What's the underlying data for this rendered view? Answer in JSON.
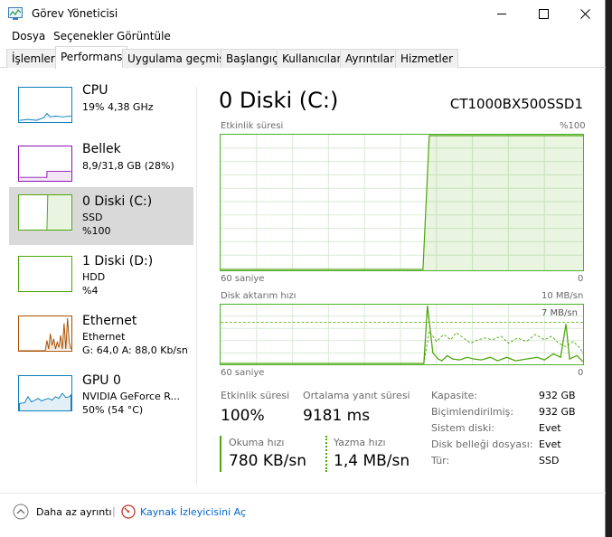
{
  "window": {
    "title": "Görev Yöneticisi",
    "minimize": "—",
    "maximize": "☐",
    "close": "✕"
  },
  "menu": [
    "Dosya",
    "Seçenekler",
    "Görüntüle"
  ],
  "tabs": [
    "İşlemler",
    "Performans",
    "Uygulama geçmişi",
    "Başlangıç",
    "Kullanıcılar",
    "Ayrıntılar",
    "Hizmetler"
  ],
  "active_tab": "Performans",
  "sidebar": {
    "items": [
      {
        "name": "CPU",
        "l1": "19% 4,38 GHz",
        "l2": "",
        "color": "#117dbb"
      },
      {
        "name": "Bellek",
        "l1": "8,9/31,8 GB (28%)",
        "l2": "",
        "color": "#8b12ae"
      },
      {
        "name": "0 Diski (C:)",
        "l1": "SSD",
        "l2": "%100",
        "color": "#4da60c"
      },
      {
        "name": "1 Diski (D:)",
        "l1": "HDD",
        "l2": "%4",
        "color": "#4da60c"
      },
      {
        "name": "Ethernet",
        "l1": "Ethernet",
        "l2": "G: 64,0  A: 88,0 Kb/sn",
        "color": "#a74f01"
      },
      {
        "name": "GPU 0",
        "l1": "NVIDIA GeForce R...",
        "l2": "50% (54 °C)",
        "color": "#117dbb"
      }
    ],
    "selected_index": 2
  },
  "main": {
    "title": "0 Diski (C:)",
    "model": "CT1000BX500SSD1",
    "graph1": {
      "label": "Etkinlik süresi",
      "max_label": "%100",
      "x_left": "60 saniye",
      "x_right": "0"
    },
    "graph2": {
      "label": "Disk aktarım hızı",
      "max_label": "10 MB/sn",
      "inner_label": "7 MB/sn",
      "x_left": "60 saniye",
      "x_right": "0"
    },
    "stats": {
      "activity_label": "Etkinlik süresi",
      "activity_value": "100%",
      "response_label": "Ortalama yanıt süresi",
      "response_value": "9181 ms",
      "read_label": "Okuma hızı",
      "read_value": "780 KB/sn",
      "write_label": "Yazma hızı",
      "write_value": "1,4 MB/sn"
    },
    "props": [
      {
        "k": "Kapasite:",
        "v": "932 GB"
      },
      {
        "k": "Biçimlendirilmiş:",
        "v": "932 GB"
      },
      {
        "k": "Sistem diski:",
        "v": "Evet"
      },
      {
        "k": "Disk belleği dosyası:",
        "v": "Evet"
      },
      {
        "k": "Tür:",
        "v": "SSD"
      }
    ]
  },
  "footer": {
    "fewer_details": "Daha az ayrıntı",
    "separator": "|",
    "open_monitor": "Kaynak İzleyicisini Aç"
  },
  "colors": {
    "disk": "#4da60c",
    "cpu": "#117dbb",
    "memory": "#8b12ae",
    "ethernet": "#a74f01",
    "link": "#0066cc"
  }
}
